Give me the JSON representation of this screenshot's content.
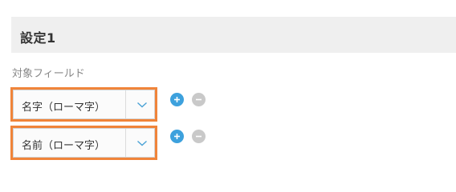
{
  "section": {
    "title": "設定1"
  },
  "field_label": "対象フィールド",
  "rows": [
    {
      "selected_value": "名字（ローマ字）"
    },
    {
      "selected_value": "名前（ローマ字）"
    }
  ],
  "icons": {
    "dropdown": "chevron-down-icon",
    "add": "plus-circle-icon",
    "remove": "minus-circle-icon"
  },
  "colors": {
    "highlight_border": "#f0843a",
    "add_button": "#3da1dd",
    "remove_button": "#c9c9c9",
    "header_bg": "#efefef"
  }
}
